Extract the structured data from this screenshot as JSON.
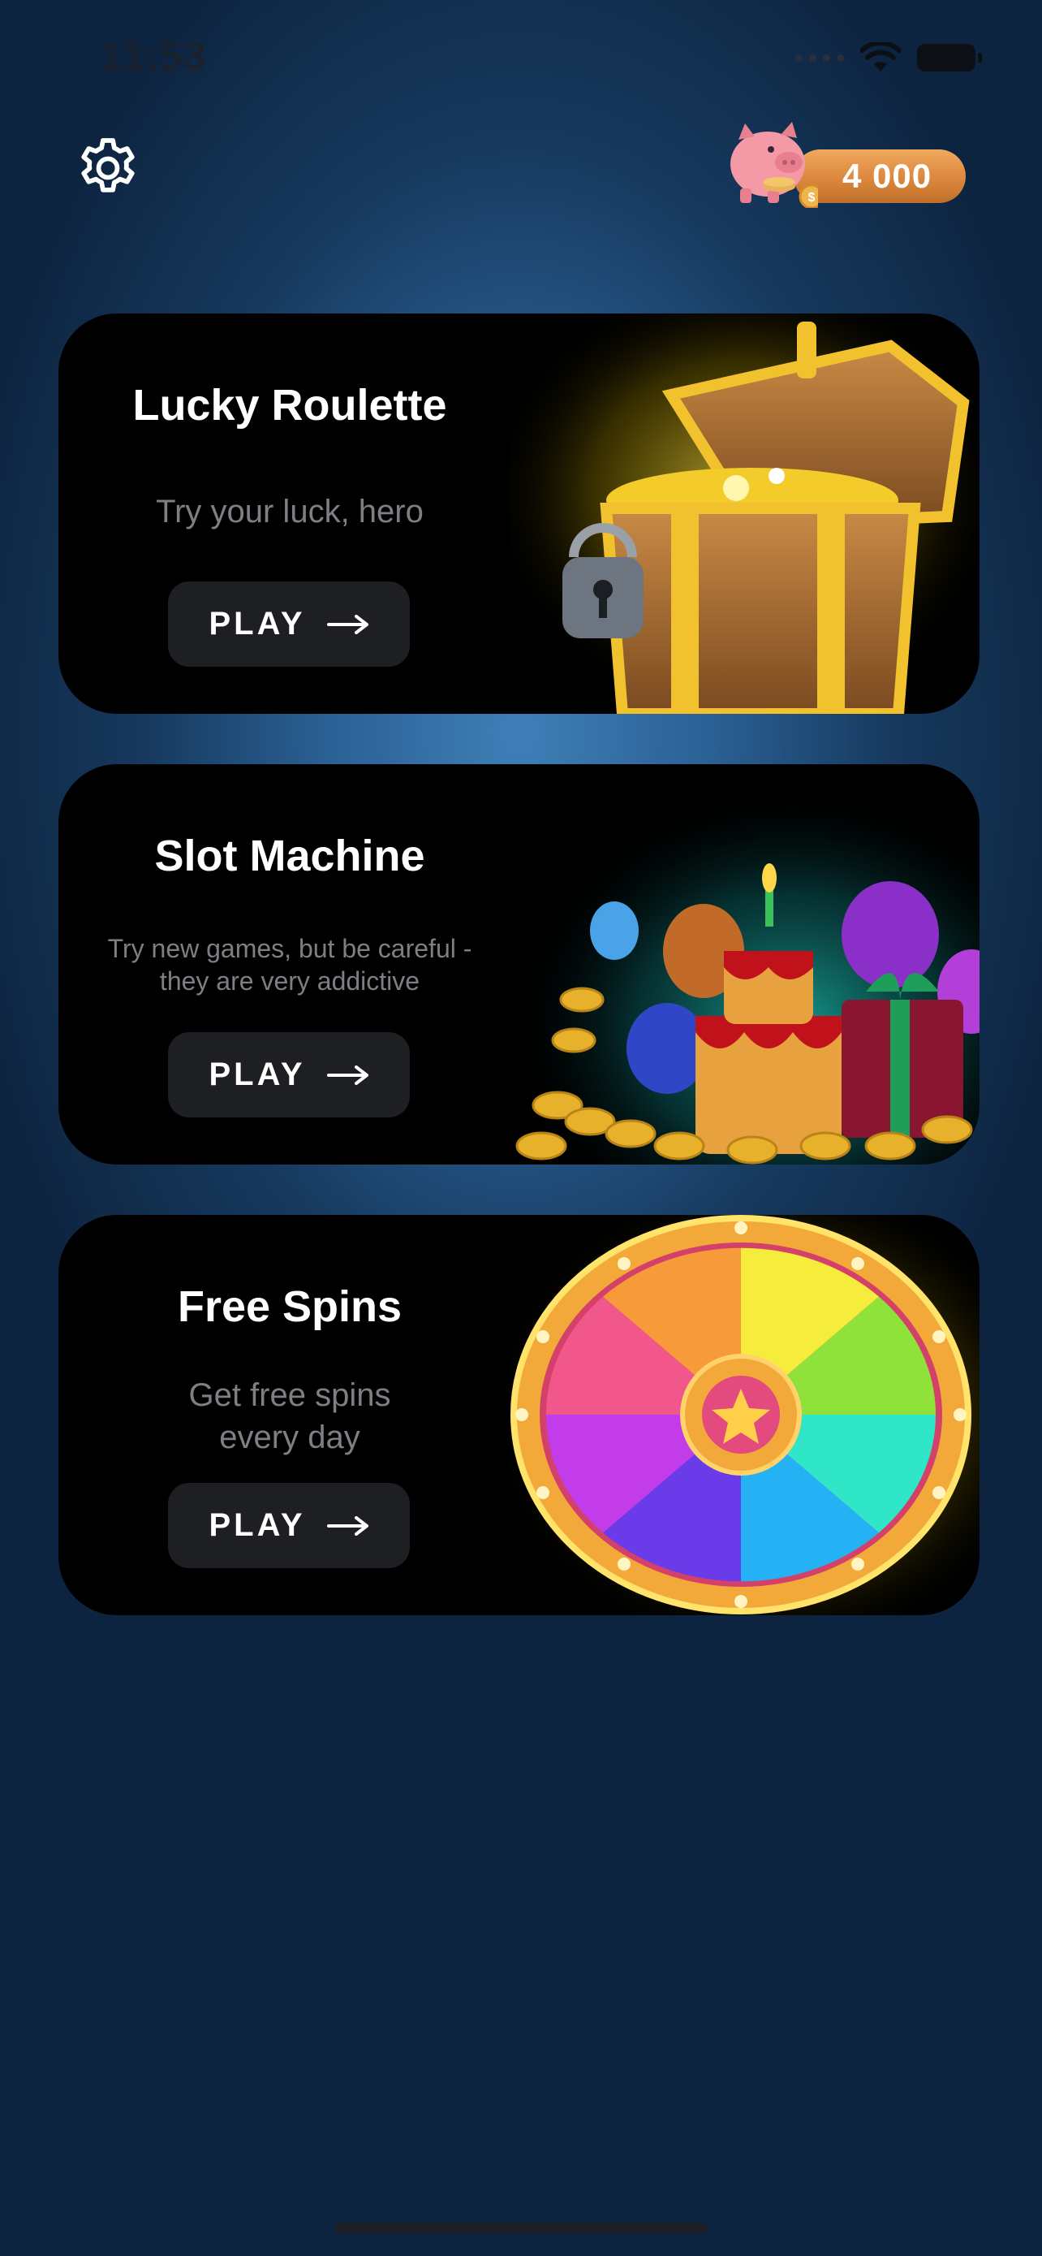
{
  "status_bar": {
    "time": "11:53"
  },
  "header": {
    "coin_balance": "4 000"
  },
  "games": [
    {
      "title": "Lucky Roulette",
      "description": "Try your luck, hero",
      "button_label": "PLAY"
    },
    {
      "title": "Slot Machine",
      "description": "Try new games, but be careful - they are very addictive",
      "button_label": "PLAY"
    },
    {
      "title": "Free Spins",
      "description": "Get free spins every day",
      "button_label": "PLAY"
    }
  ],
  "colors": {
    "background": "#2a5f93",
    "card": "#000000",
    "button": "#1d1f22",
    "coin_pill": "#d9843a",
    "description_text": "#7d7f84"
  },
  "icons": [
    "gear-icon",
    "piggy-bank-icon",
    "arrow-right-icon",
    "wifi-icon",
    "battery-icon",
    "cellular-icon"
  ]
}
